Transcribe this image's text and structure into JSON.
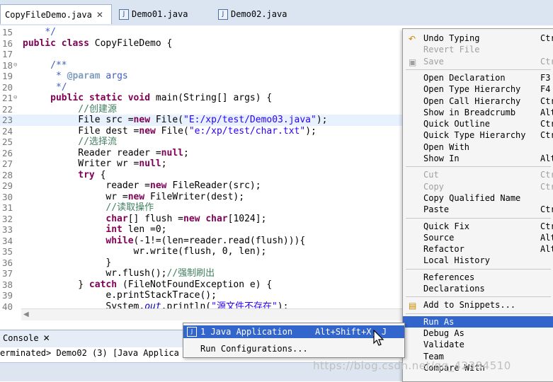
{
  "tabs": [
    {
      "label": "CopyFileDemo.java",
      "active": true
    },
    {
      "label": "Demo01.java",
      "active": false
    },
    {
      "label": "Demo02.java",
      "active": false
    }
  ],
  "editor": {
    "lines": [
      {
        "n": "15",
        "html": "    <span class=\"jd\">*/</span>"
      },
      {
        "n": "16",
        "html": "<span class=\"kw\">public</span> <span class=\"kw\">class</span> CopyFileDemo {"
      },
      {
        "n": "17",
        "html": ""
      },
      {
        "n": "18",
        "html": "     <span class=\"jd\">/**</span>",
        "fold": true
      },
      {
        "n": "19",
        "html": "      <span class=\"jd\">* </span><span class=\"tag\">@param</span><span class=\"jd\"> args</span>"
      },
      {
        "n": "20",
        "html": "      <span class=\"jd\">*/</span>"
      },
      {
        "n": "21",
        "html": "     <span class=\"kw\">public</span> <span class=\"kw\">static</span> <span class=\"kw\">void</span> main(String[] args) {",
        "fold": true
      },
      {
        "n": "22",
        "html": "          <span class=\"cm\">//<span class=\"zh\">创建源</span></span>"
      },
      {
        "n": "23",
        "html": "          File src =<span class=\"kw\">new</span> File(<span class=\"str\">\"E:/xp/test/Demo03.java\"</span>);",
        "cur": true
      },
      {
        "n": "24",
        "html": "          File dest =<span class=\"kw\">new</span> File(<span class=\"str\">\"e:/xp/test/char.txt\"</span>);"
      },
      {
        "n": "25",
        "html": "          <span class=\"cm\">//<span class=\"zh\">选择流</span></span>"
      },
      {
        "n": "26",
        "html": "          Reader reader =<span class=\"kw\">null</span>;"
      },
      {
        "n": "27",
        "html": "          Writer wr =<span class=\"kw\">null</span>;"
      },
      {
        "n": "28",
        "html": "          <span class=\"kw\">try</span> {"
      },
      {
        "n": "29",
        "html": "               reader =<span class=\"kw\">new</span> FileReader(src);"
      },
      {
        "n": "30",
        "html": "               wr =<span class=\"kw\">new</span> FileWriter(dest);"
      },
      {
        "n": "31",
        "html": "               <span class=\"cm\">//<span class=\"zh\">读取操作</span></span>"
      },
      {
        "n": "32",
        "html": "               <span class=\"kw\">char</span>[] flush =<span class=\"kw\">new</span> <span class=\"kw\">char</span>[1024];"
      },
      {
        "n": "33",
        "html": "               <span class=\"kw\">int</span> len =0;"
      },
      {
        "n": "34",
        "html": "               <span class=\"kw\">while</span>(-1!=(len=reader.read(flush))){"
      },
      {
        "n": "35",
        "html": "                    wr.write(flush, 0, len);"
      },
      {
        "n": "36",
        "html": "               }"
      },
      {
        "n": "37",
        "html": "               wr.flush();<span class=\"cm\">//<span class=\"zh\">强制刷出</span></span>"
      },
      {
        "n": "38",
        "html": "          } <span class=\"kw\">catch</span> (FileNotFoundException e) {"
      },
      {
        "n": "39",
        "html": "               e.printStackTrace();"
      },
      {
        "n": "40",
        "html": "               System.<span class=\"fld\">out</span>.println(<span class=\"str\">\"<span class=\"zh\">源文件不存在</span>\"</span>);"
      }
    ]
  },
  "console": {
    "tab_label": "Console",
    "text": "erminated> Demo02 (3) [Java Applica"
  },
  "context_menu": {
    "items": [
      {
        "label": "Undo Typing",
        "shortcut": "Ctr",
        "icon": "undo-icon"
      },
      {
        "label": "Revert File",
        "disabled": true
      },
      {
        "label": "Save",
        "shortcut": "Ctr",
        "disabled": true,
        "icon": "save-icon"
      },
      {
        "sep": true
      },
      {
        "label": "Open Declaration",
        "shortcut": "F3"
      },
      {
        "label": "Open Type Hierarchy",
        "shortcut": "F4"
      },
      {
        "label": "Open Call Hierarchy",
        "shortcut": "Ctr"
      },
      {
        "label": "Show in Breadcrumb",
        "shortcut": "Alt"
      },
      {
        "label": "Quick Outline",
        "shortcut": "Ctr"
      },
      {
        "label": "Quick Type Hierarchy",
        "shortcut": "Ctr"
      },
      {
        "label": "Open With"
      },
      {
        "label": "Show In",
        "shortcut": "Alt"
      },
      {
        "sep": true
      },
      {
        "label": "Cut",
        "shortcut": "Ctr",
        "disabled": true
      },
      {
        "label": "Copy",
        "shortcut": "Ctr",
        "disabled": true
      },
      {
        "label": "Copy Qualified Name"
      },
      {
        "label": "Paste",
        "shortcut": "Ctr"
      },
      {
        "sep": true
      },
      {
        "label": "Quick Fix",
        "shortcut": "Ctr"
      },
      {
        "label": "Source",
        "shortcut": "Alt"
      },
      {
        "label": "Refactor",
        "shortcut": "Alt"
      },
      {
        "label": "Local History"
      },
      {
        "sep": true
      },
      {
        "label": "References"
      },
      {
        "label": "Declarations"
      },
      {
        "sep": true
      },
      {
        "label": "Add to Snippets...",
        "icon": "snippet-icon"
      },
      {
        "sep": true
      },
      {
        "label": "Run As",
        "selected": true
      },
      {
        "label": "Debug As"
      },
      {
        "label": "Validate"
      },
      {
        "label": "Team"
      },
      {
        "label": "Compare With"
      }
    ]
  },
  "submenu": {
    "items": [
      {
        "label": "1 Java Application",
        "shortcut": "Alt+Shift+X, J",
        "selected": true,
        "icon": "java-app-icon"
      },
      {
        "label": "Run Configurations..."
      }
    ]
  },
  "watermark": "https://blog.csdn.net/qq_42384510"
}
